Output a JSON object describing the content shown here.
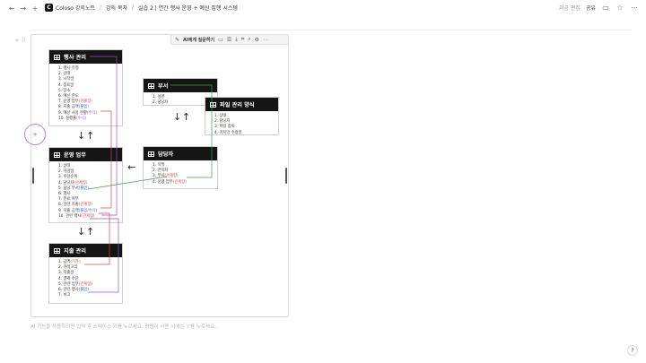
{
  "topbar": {
    "app_name": "Coloso 강의노트",
    "crumb_2": "강의 목차",
    "crumb_3": "실습 2 | 연간 행사 운영 + 예산 집행 시스템",
    "edited": "지금 편집",
    "share": "공유"
  },
  "toolbar": {
    "ai_label": "AI에게 질문하기"
  },
  "placeholder": "AI 기능을 사용하려면 입력 후 스페이스 키를 누르세요. 명령어 사용 시에는 '/'를 누르세요…",
  "cursor_label": "+",
  "arrows": {
    "down": "↓",
    "up": "↑",
    "left": "←"
  },
  "tables": {
    "event": {
      "title": "행사 관리",
      "items": [
        {
          "n": "1.",
          "t": "행사 유형",
          "tag": ""
        },
        {
          "n": "2.",
          "t": "상태",
          "tag": ""
        },
        {
          "n": "3.",
          "t": "시작일",
          "tag": ""
        },
        {
          "n": "4.",
          "t": "종료일",
          "tag": ""
        },
        {
          "n": "5.",
          "t": "장소",
          "tag": ""
        },
        {
          "n": "6.",
          "t": "예산 한도",
          "tag": ""
        },
        {
          "n": "7.",
          "t": "운영 업무",
          "tag": "(관계형)"
        },
        {
          "n": "8.",
          "t": "지출 금액",
          "tag": "(롤업)"
        },
        {
          "n": "9.",
          "t": "예산 사용 현황",
          "tag": "(수식)"
        },
        {
          "n": "10.",
          "t": "진행률",
          "tag": "(수식)"
        }
      ]
    },
    "ops": {
      "title": "운영 업무",
      "items": [
        {
          "n": "1.",
          "t": "상태",
          "tag": ""
        },
        {
          "n": "2.",
          "t": "마감일",
          "tag": ""
        },
        {
          "n": "3.",
          "t": "우선순위",
          "tag": ""
        },
        {
          "n": "4.",
          "t": "담당자",
          "tag": "(관계형)"
        },
        {
          "n": "5.",
          "t": "담당 부서",
          "tag": "(롤업)"
        },
        {
          "n": "6.",
          "t": "행사",
          "tag": ""
        },
        {
          "n": "7.",
          "t": "완료 여부",
          "tag": ""
        },
        {
          "n": "8.",
          "t": "관련 지출",
          "tag": "(관계형)"
        },
        {
          "n": "9.",
          "t": "지출 금액",
          "tag": "(롤업/수식)"
        },
        {
          "n": "10.",
          "t": "관련 행사",
          "tag": "(관계형)"
        }
      ]
    },
    "expense": {
      "title": "지출 관리",
      "items": [
        {
          "n": "1.",
          "t": "금액",
          "tag": "(기준)"
        },
        {
          "n": "2.",
          "t": "카테고리",
          "tag": ""
        },
        {
          "n": "3.",
          "t": "지출일",
          "tag": ""
        },
        {
          "n": "4.",
          "t": "결제 수단",
          "tag": ""
        },
        {
          "n": "5.",
          "t": "관련 업무",
          "tag": "(관계형)"
        },
        {
          "n": "6.",
          "t": "관련 행사",
          "tag": "(롤업)"
        },
        {
          "n": "7.",
          "t": "비고",
          "tag": ""
        }
      ]
    },
    "dept": {
      "title": "부서",
      "items": [
        {
          "n": "1.",
          "t": "설명",
          "tag": ""
        },
        {
          "n": "2.",
          "t": "담당자",
          "tag": ""
        }
      ]
    },
    "files": {
      "title": "파일 관리 양식",
      "items": [
        {
          "n": "1.",
          "t": "상태",
          "tag": ""
        },
        {
          "n": "2.",
          "t": "담당자",
          "tag": ""
        },
        {
          "n": "3.",
          "t": "파일 종류",
          "tag": ""
        },
        {
          "n": "4.",
          "t": "마지막 수정일",
          "tag": ""
        }
      ]
    },
    "staff": {
      "title": "담당자",
      "items": [
        {
          "n": "1.",
          "t": "직책",
          "tag": ""
        },
        {
          "n": "2.",
          "t": "연락처",
          "tag": ""
        },
        {
          "n": "3.",
          "t": "부서",
          "tag": "(관계형)"
        },
        {
          "n": "4.",
          "t": "운영 업무",
          "tag": "(관계형)"
        }
      ]
    }
  }
}
